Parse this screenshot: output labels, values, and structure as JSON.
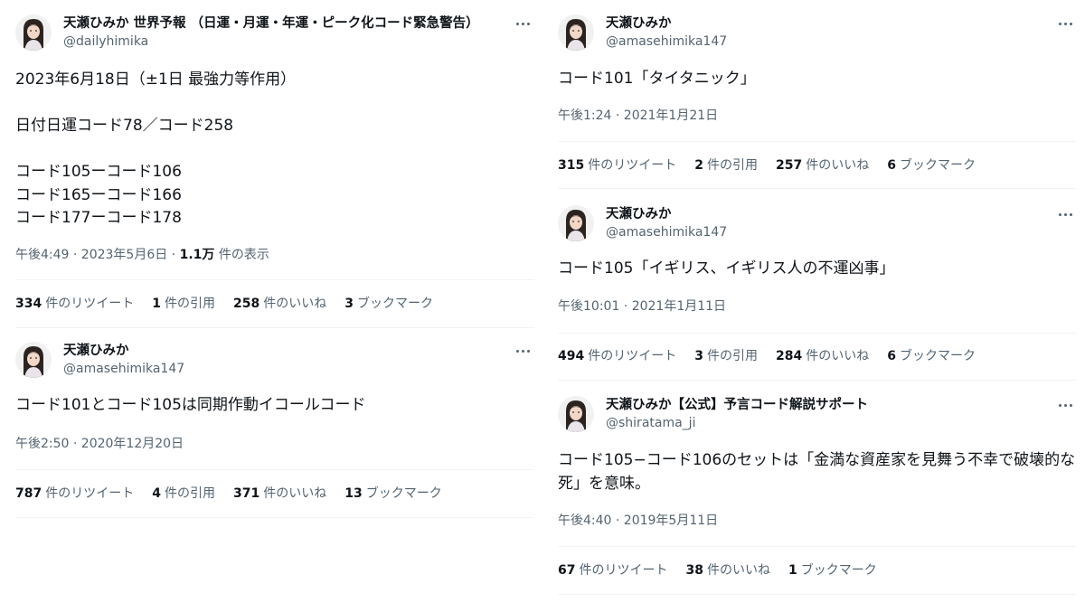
{
  "tweets": {
    "t1": {
      "name": "天瀬ひみか 世界予報 （日運・月運・年運・ピーク化コード緊急警告）",
      "handle": "@dailyhimika",
      "text": "2023年6月18日（±1日 最強力等作用）\n\n日付日運コード78／コード258\n\nコード105ーコード106\nコード165ーコード166\nコード177ーコード178",
      "time": "午後4:49 · 2023年5月6日 · ",
      "views_count": "1.1万",
      "views_label": " 件の表示",
      "retweets_count": "334",
      "retweets_label": "件のリツイート",
      "quotes_count": "1",
      "quotes_label": "件の引用",
      "likes_count": "258",
      "likes_label": "件のいいね",
      "bookmarks_count": "3",
      "bookmarks_label": "ブックマーク"
    },
    "t2": {
      "name": "天瀬ひみか",
      "handle": "@amasehimika147",
      "text": "コード101とコード105は同期作動イコールコード",
      "time": "午後2:50 · 2020年12月20日",
      "retweets_count": "787",
      "retweets_label": "件のリツイート",
      "quotes_count": "4",
      "quotes_label": "件の引用",
      "likes_count": "371",
      "likes_label": "件のいいね",
      "bookmarks_count": "13",
      "bookmarks_label": "ブックマーク"
    },
    "t3": {
      "name": "天瀬ひみか",
      "handle": "@amasehimika147",
      "text": "コード101「タイタニック」",
      "time": "午後1:24 · 2021年1月21日",
      "retweets_count": "315",
      "retweets_label": "件のリツイート",
      "quotes_count": "2",
      "quotes_label": "件の引用",
      "likes_count": "257",
      "likes_label": "件のいいね",
      "bookmarks_count": "6",
      "bookmarks_label": "ブックマーク"
    },
    "t4": {
      "name": "天瀬ひみか",
      "handle": "@amasehimika147",
      "text": "コード105「イギリス、イギリス人の不運凶事」",
      "time": "午後10:01 · 2021年1月11日",
      "retweets_count": "494",
      "retweets_label": "件のリツイート",
      "quotes_count": "3",
      "quotes_label": "件の引用",
      "likes_count": "284",
      "likes_label": "件のいいね",
      "bookmarks_count": "6",
      "bookmarks_label": "ブックマーク"
    },
    "t5": {
      "name": "天瀬ひみか【公式】予言コード解説サポート",
      "handle": "@shiratama_ji",
      "text": "コード105−コード106のセットは「金満な資産家を見舞う不幸で破壊的な\n死」を意味。",
      "time": "午後4:40 · 2019年5月11日",
      "retweets_count": "67",
      "retweets_label": "件のリツイート",
      "likes_count": "38",
      "likes_label": "件のいいね",
      "bookmarks_count": "1",
      "bookmarks_label": "ブックマーク"
    }
  },
  "icons": {
    "avatar": "profile-photo",
    "more": "more-horizontal-icon"
  },
  "colors": {
    "text": "#0f1419",
    "secondary": "#536471",
    "divider": "#eff3f4"
  }
}
